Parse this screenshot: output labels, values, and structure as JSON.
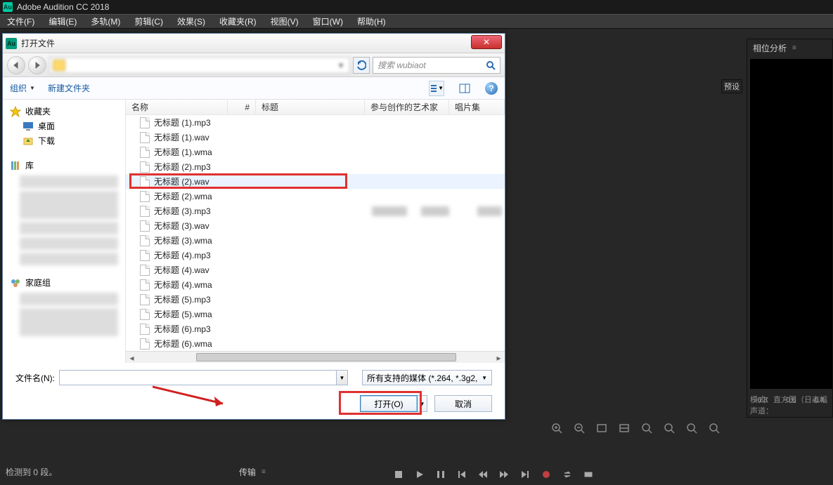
{
  "app": {
    "title": "Adobe Audition CC 2018",
    "logo_text": "Au"
  },
  "menubar": {
    "file": "文件(F)",
    "edit": "编辑(E)",
    "multitrack": "多轨(M)",
    "clip": "剪辑(C)",
    "effect": "效果(S)",
    "favorites": "收藏夹(R)",
    "view": "视图(V)",
    "window": "窗口(W)",
    "help": "帮助(H)"
  },
  "panels": {
    "phase": {
      "title": "相位分析",
      "scale": [
        "-0.8",
        "-0.6",
        "-0.4"
      ],
      "mode_label": "模式：",
      "mode_value": "直方图（日志幅",
      "channel_label": "声道："
    },
    "preset_btn": "预设"
  },
  "status": {
    "segments": "检测到 0 段。"
  },
  "transport": {
    "label": "传输"
  },
  "dialog": {
    "title": "打开文件",
    "search_placeholder": "搜索 wubiaot",
    "cmd": {
      "organize": "组织",
      "newfolder": "新建文件夹"
    },
    "sidebar": {
      "favorites": "收藏夹",
      "desktop": "桌面",
      "downloads": "下载",
      "libraries": "库",
      "homegroup": "家庭组"
    },
    "columns": {
      "name": "名称",
      "num": "#",
      "title": "标题",
      "artist": "参与创作的艺术家",
      "album": "唱片集"
    },
    "files": [
      "无标题 (1).mp3",
      "无标题 (1).wav",
      "无标题 (1).wma",
      "无标题 (2).mp3",
      "无标题 (2).wav",
      "无标题 (2).wma",
      "无标题 (3).mp3",
      "无标题 (3).wav",
      "无标题 (3).wma",
      "无标题 (4).mp3",
      "无标题 (4).wav",
      "无标题 (4).wma",
      "无标题 (5).mp3",
      "无标题 (5).wma",
      "无标题 (6).mp3",
      "无标题 (6).wma"
    ],
    "selected_index": 4,
    "filename_label": "文件名(N):",
    "filename_value": "",
    "filetype": "所有支持的媒体 (*.264, *.3g2,",
    "open": "打开(O)",
    "cancel": "取消"
  }
}
